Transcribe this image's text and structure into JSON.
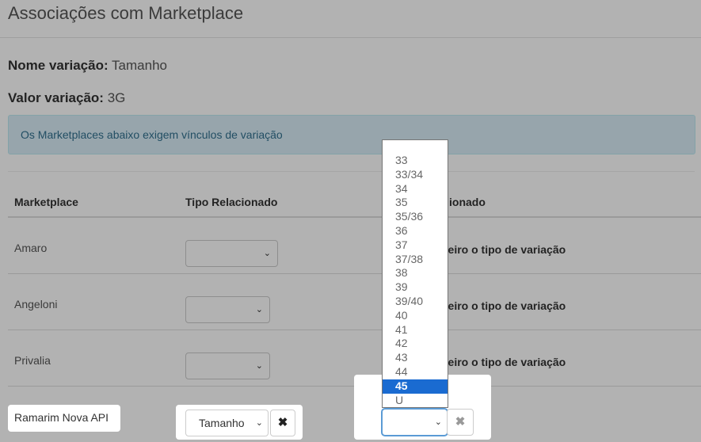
{
  "page": {
    "title": "Associações com Marketplace",
    "variation_name_label": "Nome variação:",
    "variation_name_value": "Tamanho",
    "variation_value_label": "Valor variação:",
    "variation_value_value": "3G",
    "alert_text": "Os Marketplaces abaixo exigem vínculos de variação"
  },
  "table": {
    "headers": [
      "Marketplace",
      "Tipo Relacionado",
      "Relacionado"
    ],
    "header_visible_third": "ionado",
    "hint_text": "neiro o tipo de variação",
    "rows": [
      {
        "marketplace": "Amaro"
      },
      {
        "marketplace": "Angeloni"
      },
      {
        "marketplace": "Privalia"
      }
    ]
  },
  "highlight": {
    "ramarim_label": "Ramarim Nova API",
    "tamanho_select_value": "Tamanho",
    "remove_glyph": "✖",
    "size_select_value": ""
  },
  "dropdown": {
    "options": [
      "",
      "33",
      "33/34",
      "34",
      "35",
      "35/36",
      "36",
      "37",
      "37/38",
      "38",
      "39",
      "39/40",
      "40",
      "41",
      "42",
      "43",
      "44",
      "45",
      "U"
    ],
    "highlighted": "45"
  },
  "colors": {
    "alert_bg": "#d9edf7",
    "alert_text": "#31708f",
    "selected_option": "#1a6bd1"
  }
}
